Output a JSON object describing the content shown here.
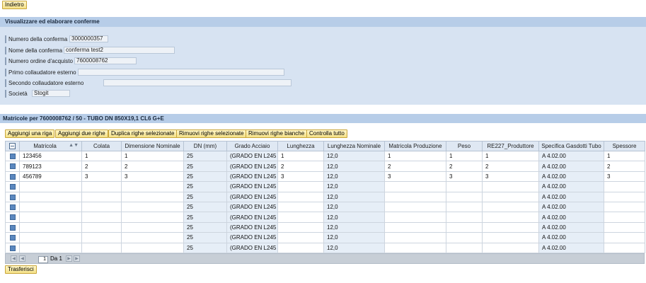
{
  "toolbar": {
    "back_label": "Indietro"
  },
  "form": {
    "header": "Visualizzare ed elaborare conferme",
    "fields": [
      {
        "label": "Numero della conferma",
        "value": "3000000357"
      },
      {
        "label": "Nome della conferma",
        "value": "conferma test2"
      },
      {
        "label": "Numero ordine d'acquisto",
        "value": "7600008762"
      },
      {
        "label": "Primo collaudatore esterno",
        "value": ""
      },
      {
        "label": "Secondo collaudatore esterno",
        "value": ""
      },
      {
        "label": "Società",
        "value": "Stogit"
      }
    ]
  },
  "table": {
    "header": "Matricole per 7600008762 / 50 - TUBO DN 850X19,1 CL6 G+E",
    "buttons": [
      "Aggiungi una riga",
      "Aggiungi due righe",
      "Duplica righe selezionate",
      "Rimuovi righe selezionate",
      "Rimuovi righe bianche",
      "Controlla tutto"
    ],
    "columns": [
      "Matricola",
      "Colata",
      "Dimensione Nominale",
      "DN (mm)",
      "Grado Acciaio",
      "Lunghezza",
      "Lunghezza Nominale",
      "Matricola Produzione",
      "Peso",
      "RE227_Produttore",
      "Specifica Gasdotti Tubo",
      "Spessore"
    ],
    "rows": [
      [
        "123456",
        "1",
        "1",
        "25",
        "(GRADO EN L245",
        "1",
        "12,0",
        "1",
        "1",
        "1",
        "A 4.02.00",
        "1"
      ],
      [
        "789123",
        "2",
        "2",
        "25",
        "(GRADO EN L245",
        "2",
        "12,0",
        "2",
        "2",
        "2",
        "A 4.02.00",
        "2"
      ],
      [
        "456789",
        "3",
        "3",
        "25",
        "(GRADO EN L245",
        "3",
        "12,0",
        "3",
        "3",
        "3",
        "A 4.02.00",
        "3"
      ],
      [
        "",
        "",
        "",
        "25",
        "(GRADO EN L245",
        "",
        "12,0",
        "",
        "",
        "",
        "A 4.02.00",
        ""
      ],
      [
        "",
        "",
        "",
        "25",
        "(GRADO EN L245",
        "",
        "12,0",
        "",
        "",
        "",
        "A 4.02.00",
        ""
      ],
      [
        "",
        "",
        "",
        "25",
        "(GRADO EN L245",
        "",
        "12,0",
        "",
        "",
        "",
        "A 4.02.00",
        ""
      ],
      [
        "",
        "",
        "",
        "25",
        "(GRADO EN L245",
        "",
        "12,0",
        "",
        "",
        "",
        "A 4.02.00",
        ""
      ],
      [
        "",
        "",
        "",
        "25",
        "(GRADO EN L245",
        "",
        "12,0",
        "",
        "",
        "",
        "A 4.02.00",
        ""
      ],
      [
        "",
        "",
        "",
        "25",
        "(GRADO EN L245",
        "",
        "12,0",
        "",
        "",
        "",
        "A 4.02.00",
        ""
      ],
      [
        "",
        "",
        "",
        "25",
        "(GRADO EN L245",
        "",
        "12,0",
        "",
        "",
        "",
        "A 4.02.00",
        ""
      ]
    ],
    "readonly_columns": [
      3,
      4,
      6,
      10
    ],
    "pager": {
      "page": "1",
      "of_label": "Da 1"
    }
  },
  "footer": {
    "transfer_label": "Trasferisci"
  },
  "icons": {
    "select_all": "select-all-icon",
    "sort": "sort-icon",
    "pager_first": "first-page-icon",
    "pager_prev": "prev-page-icon",
    "pager_next": "next-page-icon",
    "pager_last": "last-page-icon"
  }
}
